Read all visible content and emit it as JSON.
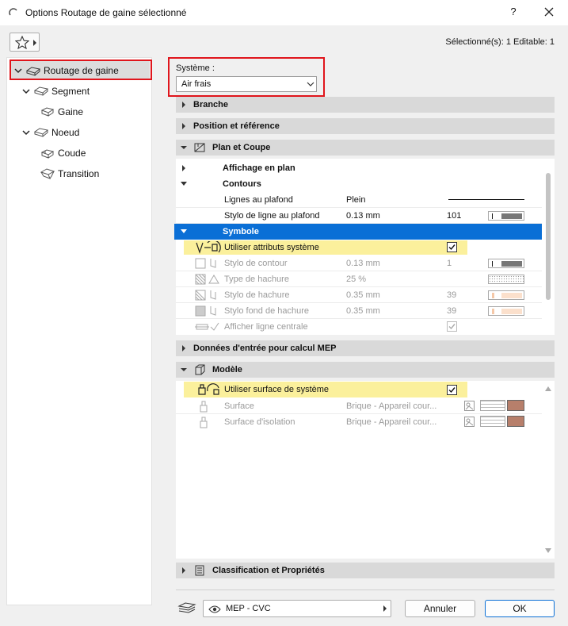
{
  "window": {
    "title": "Options Routage de gaine sélectionné",
    "help": "?",
    "close_icon": "close-icon"
  },
  "selection_info": "Sélectionné(s): 1 Editable: 1",
  "tree": {
    "root": "Routage de gaine",
    "segment": "Segment",
    "gaine": "Gaine",
    "noeud": "Noeud",
    "coude": "Coude",
    "transition": "Transition"
  },
  "systeme": {
    "label": "Système :",
    "value": "Air frais"
  },
  "sections": {
    "branche": "Branche",
    "position": "Position et référence",
    "plan": "Plan et Coupe",
    "donnees": "Données d'entrée pour calcul MEP",
    "modele": "Modèle",
    "classification": "Classification et Propriétés"
  },
  "plan": {
    "affichage": "Affichage en plan",
    "contours": "Contours",
    "lignes_label": "Lignes au plafond",
    "lignes_value": "Plein",
    "stylo_label": "Stylo de ligne au plafond",
    "stylo_value": "0.13 mm",
    "stylo_num": "101",
    "symbole": "Symbole",
    "use_attr": "Utiliser attributs système",
    "use_attr_checked": true,
    "rows": [
      {
        "label": "Stylo de contour",
        "value": "0.13 mm",
        "num": "1"
      },
      {
        "label": "Type de hachure",
        "value": "25 %",
        "num": ""
      },
      {
        "label": "Stylo de hachure",
        "value": "0.35 mm",
        "num": "39"
      },
      {
        "label": "Stylo fond de hachure",
        "value": "0.35 mm",
        "num": "39"
      },
      {
        "label": "Afficher ligne centrale",
        "value": "",
        "num": ""
      }
    ]
  },
  "modele": {
    "use_surface": "Utiliser surface de système",
    "use_surface_checked": true,
    "surface_label": "Surface",
    "surface_value": "Brique - Appareil cour...",
    "isolation_label": "Surface d'isolation",
    "isolation_value": "Brique - Appareil cour..."
  },
  "footer": {
    "view": "MEP - CVC",
    "cancel": "Annuler",
    "ok": "OK"
  },
  "colors": {
    "highlight_blue": "#0a6fd6",
    "annot_red": "#e0151c",
    "yellow": "#fbf09c",
    "brick": "#b77f6b"
  }
}
